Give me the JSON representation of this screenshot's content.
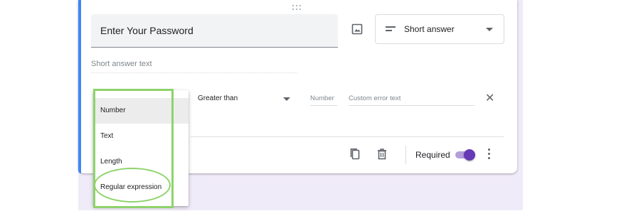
{
  "question": {
    "title": "Enter Your Password",
    "type_label": "Short answer",
    "answer_placeholder": "Short answer text"
  },
  "validation": {
    "menu_items": [
      "Number",
      "Text",
      "Length",
      "Regular expression"
    ],
    "selected_item": "Number",
    "condition": "Greater than",
    "number_placeholder": "Number",
    "error_placeholder": "Custom error text"
  },
  "footer": {
    "required_label": "Required",
    "required_on": true
  },
  "icons": {
    "drag": "drag-handle-icon",
    "image": "image-icon",
    "short_answer": "short-text-icon",
    "close": "close-icon",
    "duplicate": "copy-icon",
    "delete": "trash-icon",
    "more": "more-vert-icon"
  },
  "colors": {
    "accent": "#4285f4",
    "toggle": "#673ab7",
    "highlight": "#8ed36a",
    "background": "#f0ebf8"
  }
}
